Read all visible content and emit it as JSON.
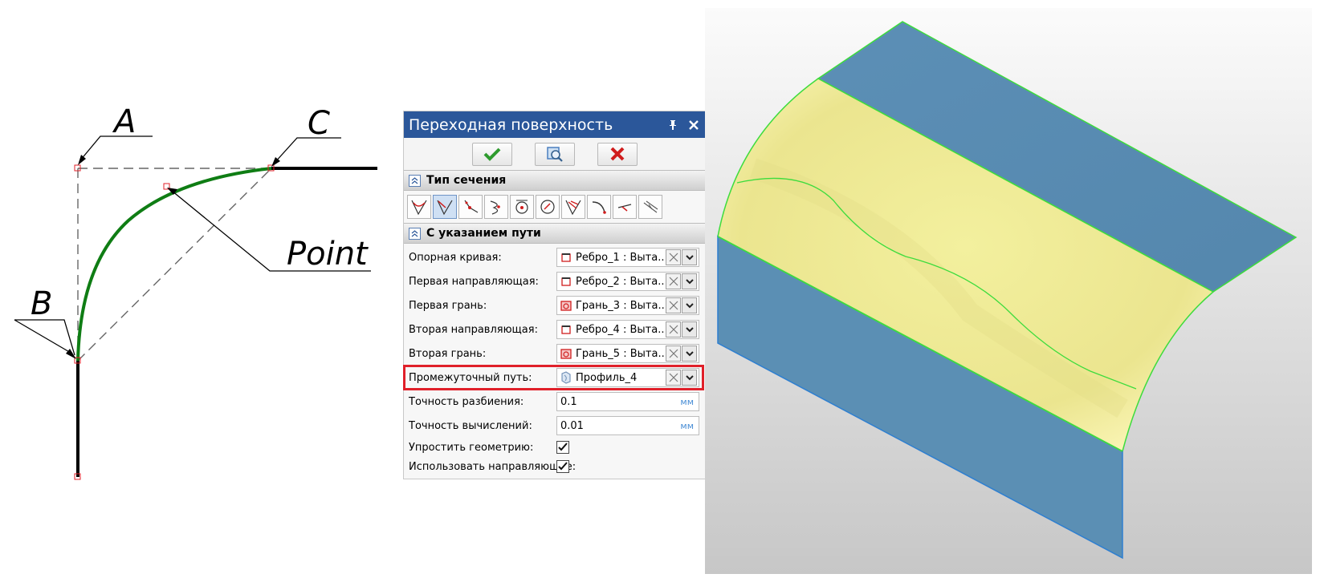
{
  "sketch": {
    "labels": {
      "a": "A",
      "b": "B",
      "c": "C",
      "point": "Point"
    }
  },
  "dialog": {
    "title": "Переходная поверхность",
    "pin_icon": "pin-icon",
    "close_icon": "close-icon",
    "actions": [
      {
        "name": "ok-button",
        "icon": "checkmark-icon",
        "color": "#2e9b2e"
      },
      {
        "name": "preview-button",
        "icon": "preview-icon",
        "color": "#4a7fc0"
      },
      {
        "name": "cancel-button",
        "icon": "cross-icon",
        "color": "#d01c1c"
      }
    ],
    "section_type": "Тип сечения",
    "section_path": "С указанием пути",
    "section_types_selected": 1,
    "fields": [
      {
        "label": "Опорная кривая:",
        "value": "Ребро_1 : Выта...",
        "icon": "edge-icon"
      },
      {
        "label": "Первая направляющая:",
        "value": "Ребро_2 : Выта...",
        "icon": "edge-icon"
      },
      {
        "label": "Первая грань:",
        "value": "Грань_3 : Выта...",
        "icon": "face-icon"
      },
      {
        "label": "Вторая направляющая:",
        "value": "Ребро_4 : Выта...",
        "icon": "edge-icon"
      },
      {
        "label": "Вторая грань:",
        "value": "Грань_5 : Выта...",
        "icon": "face-icon"
      },
      {
        "label": "Промежуточный путь:",
        "value": "Профиль_4",
        "icon": "profile-icon"
      }
    ],
    "split_accuracy": {
      "label": "Точность разбиения:",
      "value": "0.1",
      "unit": "мм"
    },
    "calc_accuracy": {
      "label": "Точность вычислений:",
      "value": "0.01",
      "unit": "мм"
    },
    "simplify": {
      "label": "Упростить геометрию:",
      "checked": true
    },
    "use_guides": {
      "label": "Использовать направляющие:",
      "checked": true
    }
  },
  "colors": {
    "titlebar": "#2b579a",
    "highlight": "#e0202a",
    "surface_yellow": "#f2ee9c",
    "faces_blue": "#5b8fb4",
    "edge_green": "#3ddc3d",
    "arc_green": "#0f7d14"
  }
}
